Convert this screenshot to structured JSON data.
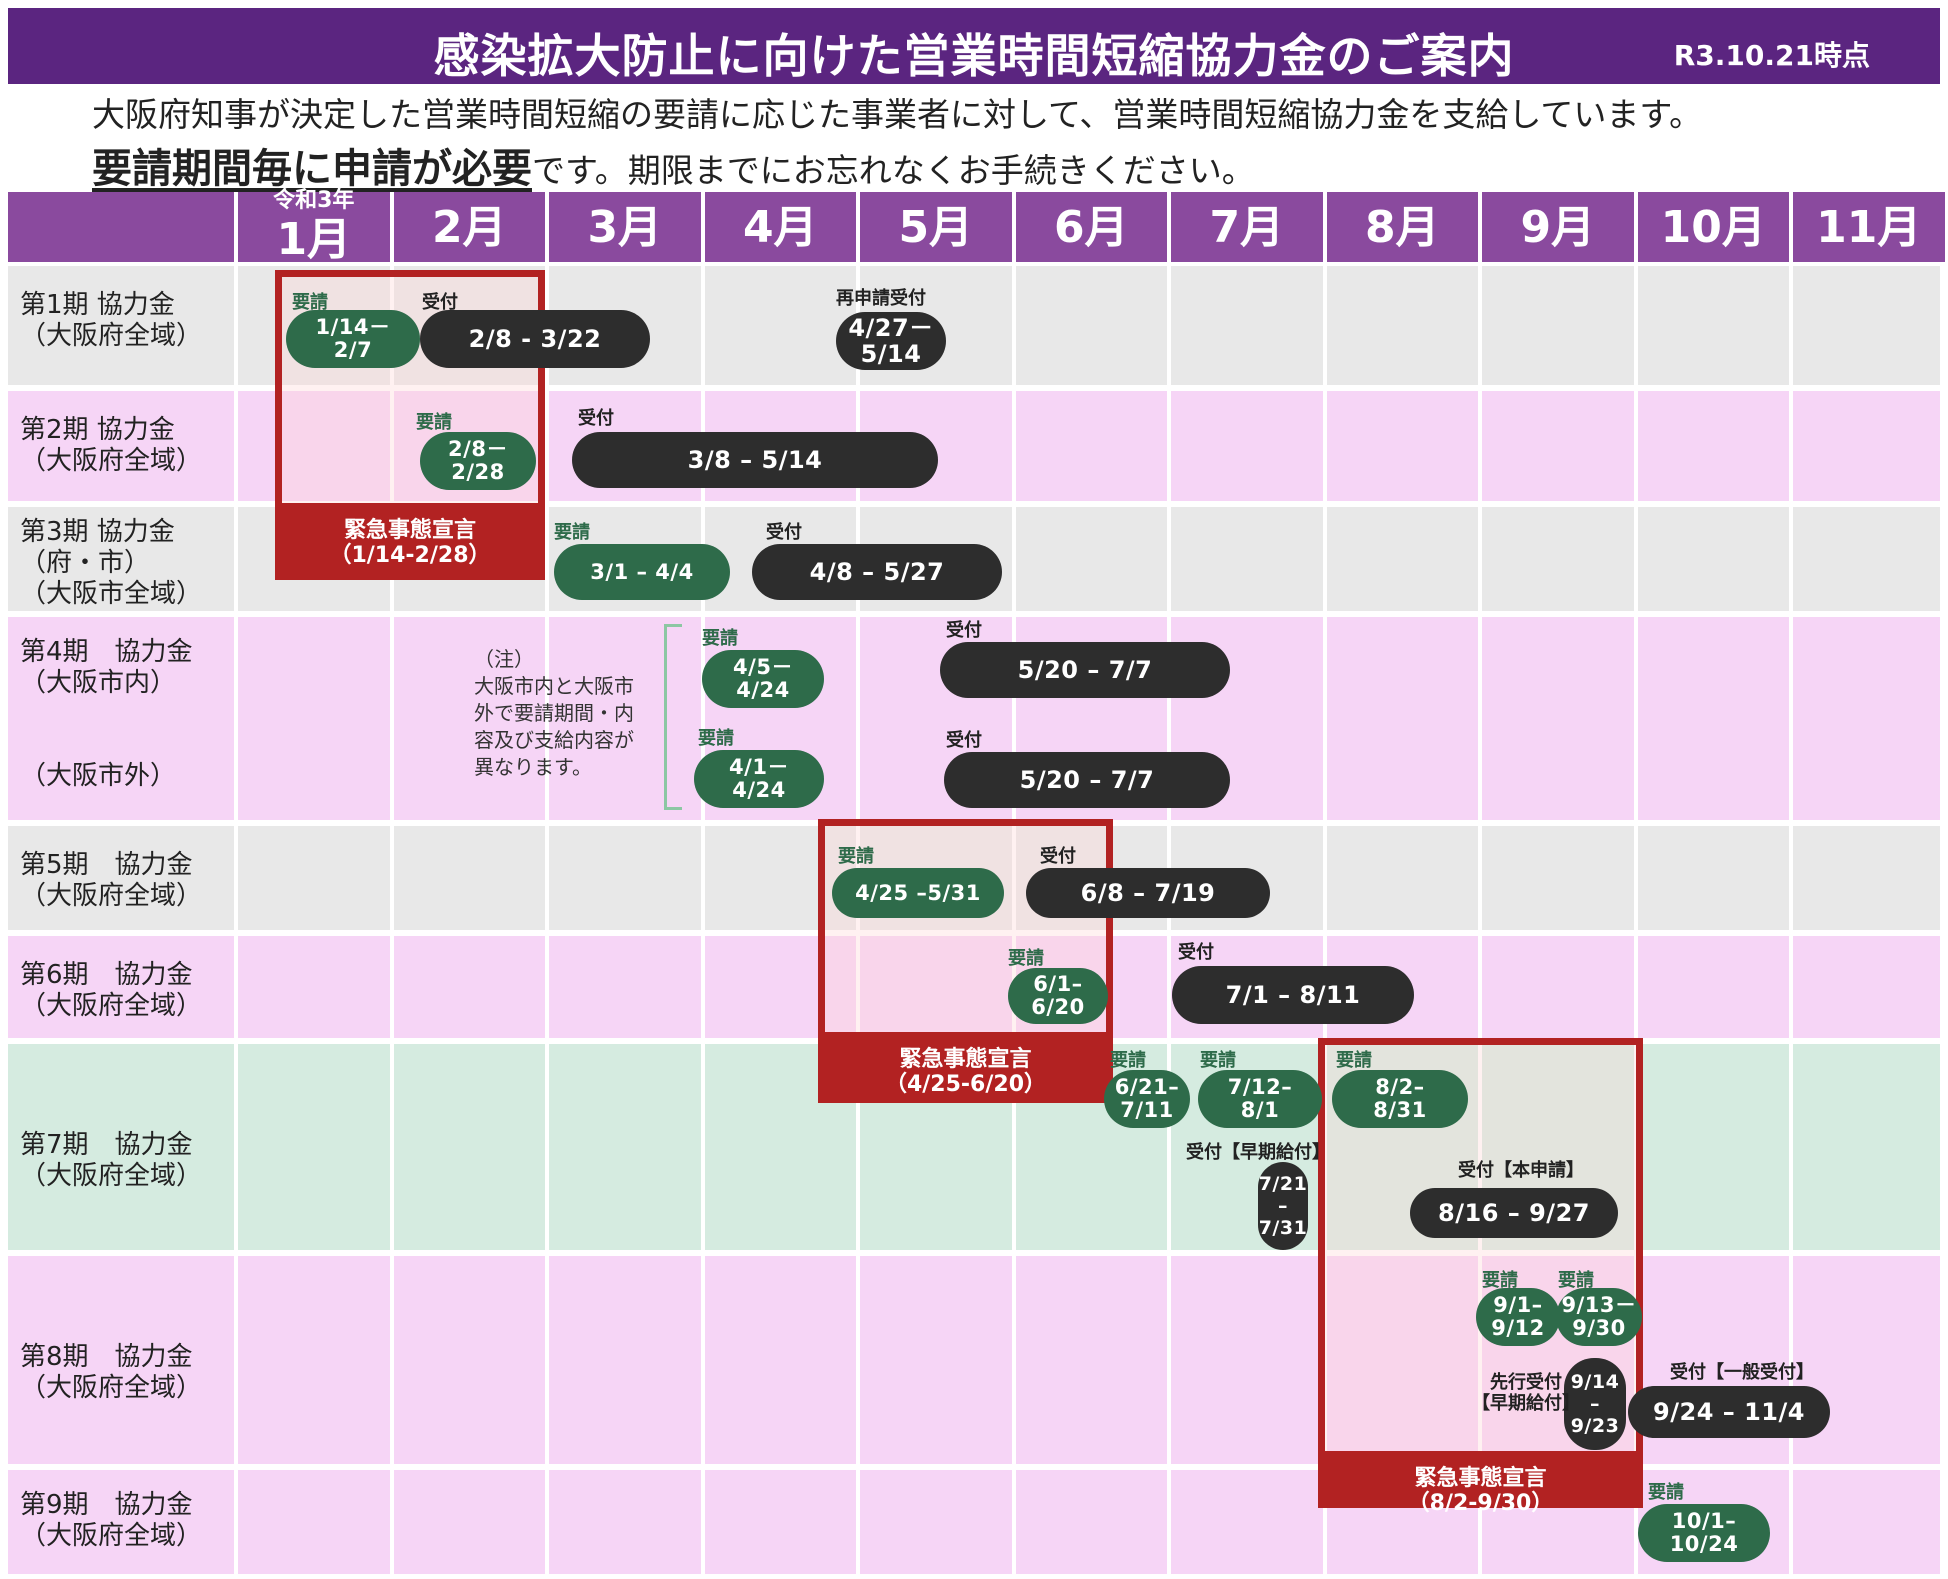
{
  "header": {
    "title": "感染拡大防止に向けた営業時間短縮協力金のご案内",
    "date": "R3.10.21時点"
  },
  "intro": {
    "line1": "大阪府知事が決定した営業時間短縮の要請に応じた事業者に対して、営業時間短縮協力金を支給しています。",
    "emphasis": "要請期間毎に申請が必要",
    "rest": "です。期限までにお忘れなくお手続きください。"
  },
  "months": {
    "reiwa_label": "令和3年",
    "labels": [
      "1月",
      "2月",
      "3月",
      "4月",
      "5月",
      "6月",
      "7月",
      "8月",
      "9月",
      "10月",
      "11月"
    ]
  },
  "tags": {
    "request": "要請",
    "receipt": "受付",
    "re_application": "再申請受付",
    "early_receipt": "受付【早期給付】",
    "main_application": "受付【本申請】",
    "advance_receipt": "先行受付",
    "early_payment": "【早期給付】",
    "general_receipt": "受付【一般受付】"
  },
  "note": "（注）\n大阪市内と大阪市\n外で要請期間・内\n容及び支給内容が\n異なります。",
  "emergency": [
    {
      "label": "緊急事態宣言",
      "period": "（1/14-2/28）"
    },
    {
      "label": "緊急事態宣言",
      "period": "（4/25-6/20）"
    },
    {
      "label": "緊急事態宣言",
      "period": "（8/2-9/30）"
    }
  ],
  "chart_data": {
    "type": "table",
    "title": "感染拡大防止に向けた営業時間短縮協力金のご案内",
    "columns": [
      "1月",
      "2月",
      "3月",
      "4月",
      "5月",
      "6月",
      "7月",
      "8月",
      "9月",
      "10月",
      "11月"
    ],
    "rows": [
      {
        "label": "第1期 協力金\n（大阪府全域）",
        "bg": "#e8e8e8",
        "items": [
          {
            "kind": "request",
            "text": "1/14－\n2/7",
            "start": "01-14",
            "end": "02-07"
          },
          {
            "kind": "receipt",
            "text": "2/8 - 3/22",
            "start": "02-08",
            "end": "03-22"
          },
          {
            "kind": "receipt",
            "tag": "再申請受付",
            "text": "4/27－\n5/14",
            "start": "04-27",
            "end": "05-14"
          }
        ]
      },
      {
        "label": "第2期 協力金\n（大阪府全域）",
        "bg": "#f6d5f6",
        "items": [
          {
            "kind": "request",
            "text": "2/8－\n2/28",
            "start": "02-08",
            "end": "02-28"
          },
          {
            "kind": "receipt",
            "text": "3/8 – 5/14",
            "start": "03-08",
            "end": "05-14"
          }
        ]
      },
      {
        "label": "第3期 協力金\n（府・市）\n（大阪市全域）",
        "bg": "#e8e8e8",
        "items": [
          {
            "kind": "request",
            "text": "3/1 – 4/4",
            "start": "03-01",
            "end": "04-04"
          },
          {
            "kind": "receipt",
            "text": "4/8 – 5/27",
            "start": "04-08",
            "end": "05-27"
          }
        ]
      },
      {
        "label": "第4期　協力金\n（大阪市内）\n\n\n（大阪市外）",
        "bg": "#f6d5f6",
        "items": [
          {
            "kind": "request",
            "area": "大阪市内",
            "text": "4/5－\n4/24",
            "start": "04-05",
            "end": "04-24"
          },
          {
            "kind": "receipt",
            "area": "大阪市内",
            "text": "5/20 – 7/7",
            "start": "05-20",
            "end": "07-07"
          },
          {
            "kind": "request",
            "area": "大阪市外",
            "text": "4/1－\n4/24",
            "start": "04-01",
            "end": "04-24"
          },
          {
            "kind": "receipt",
            "area": "大阪市外",
            "text": "5/20 – 7/7",
            "start": "05-20",
            "end": "07-07"
          }
        ]
      },
      {
        "label": "第5期　協力金\n（大阪府全域）",
        "bg": "#e8e8e8",
        "items": [
          {
            "kind": "request",
            "text": "4/25 –5/31",
            "start": "04-25",
            "end": "05-31"
          },
          {
            "kind": "receipt",
            "text": "6/8 – 7/19",
            "start": "06-08",
            "end": "07-19"
          }
        ]
      },
      {
        "label": "第6期　協力金\n（大阪府全域）",
        "bg": "#f6d5f6",
        "items": [
          {
            "kind": "request",
            "text": "6/1–\n6/20",
            "start": "06-01",
            "end": "06-20"
          },
          {
            "kind": "receipt",
            "text": "7/1 – 8/11",
            "start": "07-01",
            "end": "08-11"
          }
        ]
      },
      {
        "label": "第7期　協力金\n（大阪府全域）",
        "bg": "#d5ebe0",
        "items": [
          {
            "kind": "request",
            "text": "6/21–\n7/11",
            "start": "06-21",
            "end": "07-11"
          },
          {
            "kind": "request",
            "text": "7/12–\n8/1",
            "start": "07-12",
            "end": "08-01"
          },
          {
            "kind": "request",
            "text": "8/2–\n8/31",
            "start": "08-02",
            "end": "08-31"
          },
          {
            "kind": "receipt",
            "tag": "受付【早期給付】",
            "text": "7/21\n–\n7/31",
            "start": "07-21",
            "end": "07-31"
          },
          {
            "kind": "receipt",
            "tag": "受付【本申請】",
            "text": "8/16 – 9/27",
            "start": "08-16",
            "end": "09-27"
          }
        ]
      },
      {
        "label": "第8期　協力金\n（大阪府全域）",
        "bg": "#f6d5f6",
        "items": [
          {
            "kind": "request",
            "text": "9/1–\n9/12",
            "start": "09-01",
            "end": "09-12"
          },
          {
            "kind": "request",
            "text": "9/13－\n9/30",
            "start": "09-13",
            "end": "09-30"
          },
          {
            "kind": "receipt",
            "tag": "先行受付【早期給付】",
            "text": "9/14\n–\n9/23",
            "start": "09-14",
            "end": "09-23"
          },
          {
            "kind": "receipt",
            "tag": "受付【一般受付】",
            "text": "9/24 – 11/4",
            "start": "09-24",
            "end": "11-04"
          }
        ]
      },
      {
        "label": "第9期　協力金\n（大阪府全域）",
        "bg": "#f6d5f6",
        "items": [
          {
            "kind": "request",
            "text": "10/1–\n10/24",
            "start": "10-01",
            "end": "10-24"
          }
        ]
      }
    ],
    "emergency_declarations": [
      {
        "text": "緊急事態宣言（1/14-2/28）",
        "start": "01-14",
        "end": "02-28"
      },
      {
        "text": "緊急事態宣言（4/25-6/20）",
        "start": "04-25",
        "end": "06-20"
      },
      {
        "text": "緊急事態宣言（8/2-9/30）",
        "start": "08-02",
        "end": "09-30"
      }
    ]
  }
}
